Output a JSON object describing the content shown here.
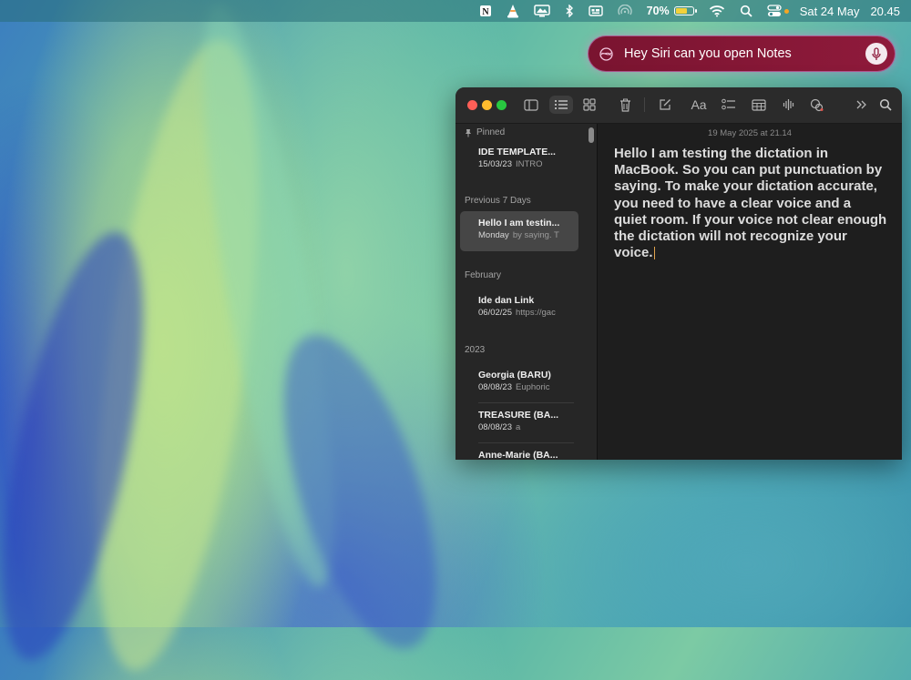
{
  "menubar": {
    "battery_percent": "70%",
    "battery_level": 0.7,
    "date": "Sat 24 May",
    "time": "20.45",
    "icons": [
      "notion-icon",
      "vlc-icon",
      "display-icon",
      "bluetooth-icon",
      "keyboard-input-icon",
      "airdrop-icon",
      "battery-icon",
      "wifi-icon",
      "search-icon",
      "control-center-icon"
    ]
  },
  "siri": {
    "text": "Hey Siri can you open Notes",
    "icons": [
      "siri-orb-icon",
      "microphone-icon"
    ]
  },
  "notes_window": {
    "toolbar_icons": [
      "sidebar-toggle-icon",
      "list-view-icon",
      "gallery-view-icon",
      "trash-icon",
      "compose-icon",
      "format-text-icon",
      "checklist-icon",
      "table-icon",
      "audio-icon",
      "share-icon",
      "more-icon",
      "search-icon"
    ],
    "format_label": "Aa",
    "sidebar": {
      "pinned_header": "Pinned",
      "sections": [
        {
          "header": "Previous 7 Days"
        },
        {
          "header": "February"
        },
        {
          "header": "2023"
        }
      ],
      "notes": [
        {
          "title": "IDE TEMPLATE...",
          "date": "15/03/23",
          "preview": "INTRO"
        },
        {
          "title": "Hello I am testin...",
          "date": "Monday",
          "preview": "by saying. T"
        },
        {
          "title": "Ide dan Link",
          "date": "06/02/25",
          "preview": "https://gac"
        },
        {
          "title": "Georgia (BARU)",
          "date": "08/08/23",
          "preview": "Euphoric"
        },
        {
          "title": "TREASURE (BA...",
          "date": "08/08/23",
          "preview": "a"
        },
        {
          "title": "Anne-Marie (BA...",
          "date": "",
          "preview": ""
        }
      ]
    },
    "editor": {
      "date": "19 May 2025 at 21.14",
      "body": "Hello I am testing the dictation in MacBook. So you can put punctuation by saying. To make your dictation accurate, you need to have a clear voice and a quiet room. If your voice not clear enough the dictation will not recognize your voice."
    }
  },
  "colors": {
    "siri_bg": "#8f1a3b",
    "traffic_red": "#ff5f57",
    "traffic_yellow": "#febc2e",
    "traffic_green": "#28c840",
    "battery_fill": "#f2d13a"
  }
}
